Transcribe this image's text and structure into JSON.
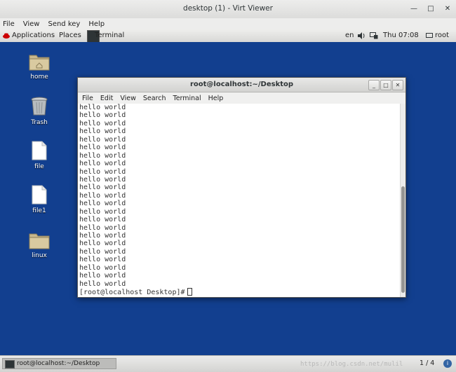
{
  "viewer": {
    "title": "desktop (1) - Virt Viewer",
    "menu": [
      "File",
      "View",
      "Send key",
      "Help"
    ]
  },
  "guest_panel": {
    "applications": "Applications",
    "places": "Places",
    "terminal": "Terminal",
    "lang": "en",
    "clock": "Thu 07:08",
    "user": "root"
  },
  "desktop_icons": [
    {
      "label": "home"
    },
    {
      "label": "Trash"
    },
    {
      "label": "file"
    },
    {
      "label": "file1"
    },
    {
      "label": "linux"
    }
  ],
  "terminal": {
    "title": "root@localhost:~/Desktop",
    "menu": [
      "File",
      "Edit",
      "View",
      "Search",
      "Terminal",
      "Help"
    ],
    "lines": [
      "hello world",
      "hello world",
      "hello world",
      "hello world",
      "hello world",
      "hello world",
      "hello world",
      "hello world",
      "hello world",
      "hello world",
      "hello world",
      "hello world",
      "hello world",
      "hello world",
      "hello world",
      "hello world",
      "hello world",
      "hello world",
      "hello world",
      "hello world",
      "hello world",
      "hello world",
      "hello world"
    ],
    "prompt": "[root@localhost Desktop]#"
  },
  "taskbar": {
    "item": "root@localhost:~/Desktop",
    "workspace": "1 / 4",
    "watermark": "https://blog.csdn.net/mulil"
  },
  "colors": {
    "desktop": "#123f8f",
    "folder": "#c8b88e",
    "accent": "#3465a4"
  }
}
